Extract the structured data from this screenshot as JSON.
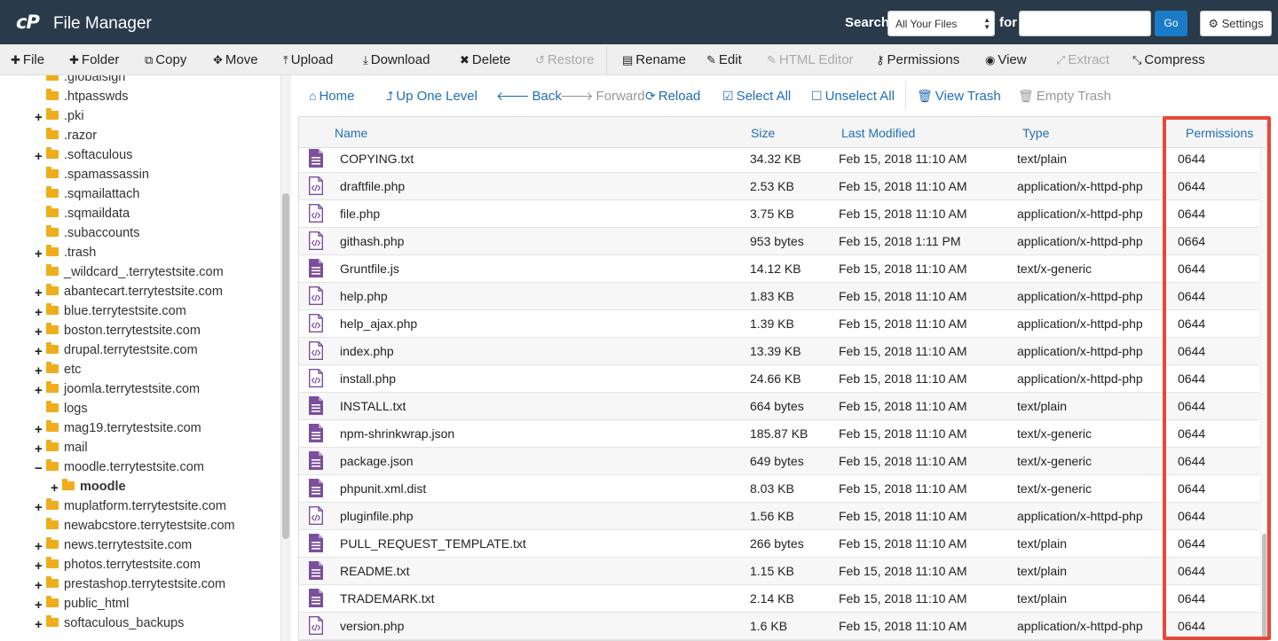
{
  "header": {
    "logo": "cP",
    "title": "File Manager",
    "search_label": "Search",
    "search_scope": "All Your Files",
    "for_label": "for",
    "search_value": "",
    "go_label": "Go",
    "settings_label": "Settings"
  },
  "toolbar": {
    "file": "File",
    "folder": "Folder",
    "copy": "Copy",
    "move": "Move",
    "upload": "Upload",
    "download": "Download",
    "delete": "Delete",
    "restore": "Restore",
    "rename": "Rename",
    "edit": "Edit",
    "html_editor": "HTML Editor",
    "permissions": "Permissions",
    "view": "View",
    "extract": "Extract",
    "compress": "Compress"
  },
  "nav": {
    "home": "Home",
    "up_one_level": "Up One Level",
    "back": "Back",
    "forward": "Forward",
    "reload": "Reload",
    "select_all": "Select All",
    "unselect_all": "Unselect All",
    "view_trash": "View Trash",
    "empty_trash": "Empty Trash"
  },
  "tree": [
    {
      "label": ".globalsign",
      "expandable": false
    },
    {
      "label": ".htpasswds",
      "expandable": false
    },
    {
      "label": ".pki",
      "expandable": true
    },
    {
      "label": ".razor",
      "expandable": false
    },
    {
      "label": ".softaculous",
      "expandable": true
    },
    {
      "label": ".spamassassin",
      "expandable": false
    },
    {
      "label": ".sqmailattach",
      "expandable": false
    },
    {
      "label": ".sqmaildata",
      "expandable": false
    },
    {
      "label": ".subaccounts",
      "expandable": false
    },
    {
      "label": ".trash",
      "expandable": true
    },
    {
      "label": "_wildcard_.terrytestsite.com",
      "expandable": false
    },
    {
      "label": "abantecart.terrytestsite.com",
      "expandable": true
    },
    {
      "label": "blue.terrytestsite.com",
      "expandable": true
    },
    {
      "label": "boston.terrytestsite.com",
      "expandable": true
    },
    {
      "label": "drupal.terrytestsite.com",
      "expandable": true
    },
    {
      "label": "etc",
      "expandable": true
    },
    {
      "label": "joomla.terrytestsite.com",
      "expandable": true
    },
    {
      "label": "logs",
      "expandable": false
    },
    {
      "label": "mag19.terrytestsite.com",
      "expandable": true
    },
    {
      "label": "mail",
      "expandable": true
    },
    {
      "label": "moodle.terrytestsite.com",
      "expandable": true,
      "expanded": true
    },
    {
      "label": "moodle",
      "expandable": true,
      "child": true,
      "bold": true
    },
    {
      "label": "muplatform.terrytestsite.com",
      "expandable": true
    },
    {
      "label": "newabcstore.terrytestsite.com",
      "expandable": false
    },
    {
      "label": "news.terrytestsite.com",
      "expandable": true
    },
    {
      "label": "photos.terrytestsite.com",
      "expandable": true
    },
    {
      "label": "prestashop.terrytestsite.com",
      "expandable": true
    },
    {
      "label": "public_html",
      "expandable": true
    },
    {
      "label": "softaculous_backups",
      "expandable": true
    }
  ],
  "table": {
    "columns": [
      "Name",
      "Size",
      "Last Modified",
      "Type",
      "Permissions"
    ],
    "rows": [
      {
        "name": "COPYING.txt",
        "size": "34.32 KB",
        "modified": "Feb 15, 2018 11:10 AM",
        "type": "text/plain",
        "perms": "0644",
        "icon": "text-file-icon"
      },
      {
        "name": "draftfile.php",
        "size": "2.53 KB",
        "modified": "Feb 15, 2018 11:10 AM",
        "type": "application/x-httpd-php",
        "perms": "0644",
        "icon": "code-file-icon"
      },
      {
        "name": "file.php",
        "size": "3.75 KB",
        "modified": "Feb 15, 2018 11:10 AM",
        "type": "application/x-httpd-php",
        "perms": "0644",
        "icon": "code-file-icon"
      },
      {
        "name": "githash.php",
        "size": "953 bytes",
        "modified": "Feb 15, 2018 1:11 PM",
        "type": "application/x-httpd-php",
        "perms": "0664",
        "icon": "code-file-icon"
      },
      {
        "name": "Gruntfile.js",
        "size": "14.12 KB",
        "modified": "Feb 15, 2018 11:10 AM",
        "type": "text/x-generic",
        "perms": "0644",
        "icon": "text-file-icon"
      },
      {
        "name": "help.php",
        "size": "1.83 KB",
        "modified": "Feb 15, 2018 11:10 AM",
        "type": "application/x-httpd-php",
        "perms": "0644",
        "icon": "code-file-icon"
      },
      {
        "name": "help_ajax.php",
        "size": "1.39 KB",
        "modified": "Feb 15, 2018 11:10 AM",
        "type": "application/x-httpd-php",
        "perms": "0644",
        "icon": "code-file-icon"
      },
      {
        "name": "index.php",
        "size": "13.39 KB",
        "modified": "Feb 15, 2018 11:10 AM",
        "type": "application/x-httpd-php",
        "perms": "0644",
        "icon": "code-file-icon"
      },
      {
        "name": "install.php",
        "size": "24.66 KB",
        "modified": "Feb 15, 2018 11:10 AM",
        "type": "application/x-httpd-php",
        "perms": "0644",
        "icon": "code-file-icon"
      },
      {
        "name": "INSTALL.txt",
        "size": "664 bytes",
        "modified": "Feb 15, 2018 11:10 AM",
        "type": "text/plain",
        "perms": "0644",
        "icon": "text-file-icon"
      },
      {
        "name": "npm-shrinkwrap.json",
        "size": "185.87 KB",
        "modified": "Feb 15, 2018 11:10 AM",
        "type": "text/x-generic",
        "perms": "0644",
        "icon": "text-file-icon"
      },
      {
        "name": "package.json",
        "size": "649 bytes",
        "modified": "Feb 15, 2018 11:10 AM",
        "type": "text/x-generic",
        "perms": "0644",
        "icon": "text-file-icon"
      },
      {
        "name": "phpunit.xml.dist",
        "size": "8.03 KB",
        "modified": "Feb 15, 2018 11:10 AM",
        "type": "text/x-generic",
        "perms": "0644",
        "icon": "text-file-icon"
      },
      {
        "name": "pluginfile.php",
        "size": "1.56 KB",
        "modified": "Feb 15, 2018 11:10 AM",
        "type": "application/x-httpd-php",
        "perms": "0644",
        "icon": "code-file-icon"
      },
      {
        "name": "PULL_REQUEST_TEMPLATE.txt",
        "size": "266 bytes",
        "modified": "Feb 15, 2018 11:10 AM",
        "type": "text/plain",
        "perms": "0644",
        "icon": "text-file-icon"
      },
      {
        "name": "README.txt",
        "size": "1.15 KB",
        "modified": "Feb 15, 2018 11:10 AM",
        "type": "text/plain",
        "perms": "0644",
        "icon": "text-file-icon"
      },
      {
        "name": "TRADEMARK.txt",
        "size": "2.14 KB",
        "modified": "Feb 15, 2018 11:10 AM",
        "type": "text/plain",
        "perms": "0644",
        "icon": "text-file-icon"
      },
      {
        "name": "version.php",
        "size": "1.6 KB",
        "modified": "Feb 15, 2018 11:10 AM",
        "type": "application/x-httpd-php",
        "perms": "0644",
        "icon": "code-file-icon"
      }
    ]
  },
  "colors": {
    "header_bg": "#293a4a",
    "accent": "#1f6fb5",
    "highlight": "#e8483b",
    "folder": "#f0ad1b",
    "file_icon": "#7b4f9d"
  }
}
